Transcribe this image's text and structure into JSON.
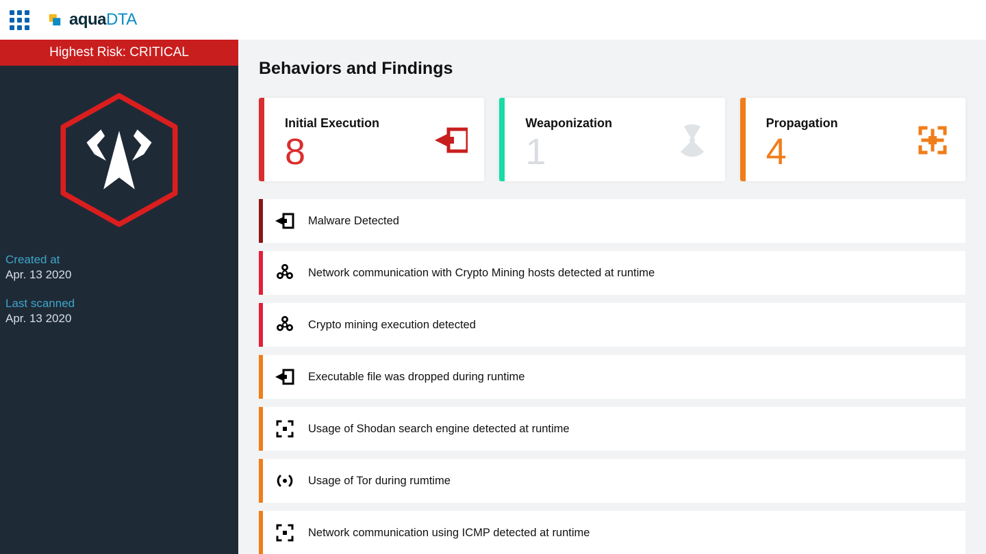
{
  "brand": {
    "name_bold": "aqua",
    "name_light": "DTA"
  },
  "sidebar": {
    "risk_banner": "Highest Risk: CRITICAL",
    "created_label": "Created at",
    "created_value": "Apr. 13 2020",
    "scanned_label": "Last scanned",
    "scanned_value": "Apr. 13 2020"
  },
  "main": {
    "section_title": "Behaviors and Findings",
    "cards": [
      {
        "title": "Initial Execution",
        "value": "8",
        "tone": "red",
        "icon": "target"
      },
      {
        "title": "Weaponization",
        "value": "1",
        "tone": "teal",
        "icon": "radiation"
      },
      {
        "title": "Propagation",
        "value": "4",
        "tone": "orange",
        "icon": "propagate"
      }
    ],
    "findings": [
      {
        "severity": "darkred",
        "icon": "target",
        "text": "Malware Detected"
      },
      {
        "severity": "red",
        "icon": "biohazard",
        "text": "Network communication with Crypto Mining hosts detected at runtime"
      },
      {
        "severity": "red",
        "icon": "biohazard",
        "text": "Crypto mining execution detected"
      },
      {
        "severity": "orange",
        "icon": "target",
        "text": "Executable file was dropped during runtime"
      },
      {
        "severity": "orange",
        "icon": "propagate",
        "text": "Usage of Shodan search engine detected at runtime"
      },
      {
        "severity": "orange",
        "icon": "broadcast",
        "text": "Usage of Tor during rumtime"
      },
      {
        "severity": "orange",
        "icon": "propagate",
        "text": "Network communication using ICMP detected at runtime"
      }
    ]
  }
}
